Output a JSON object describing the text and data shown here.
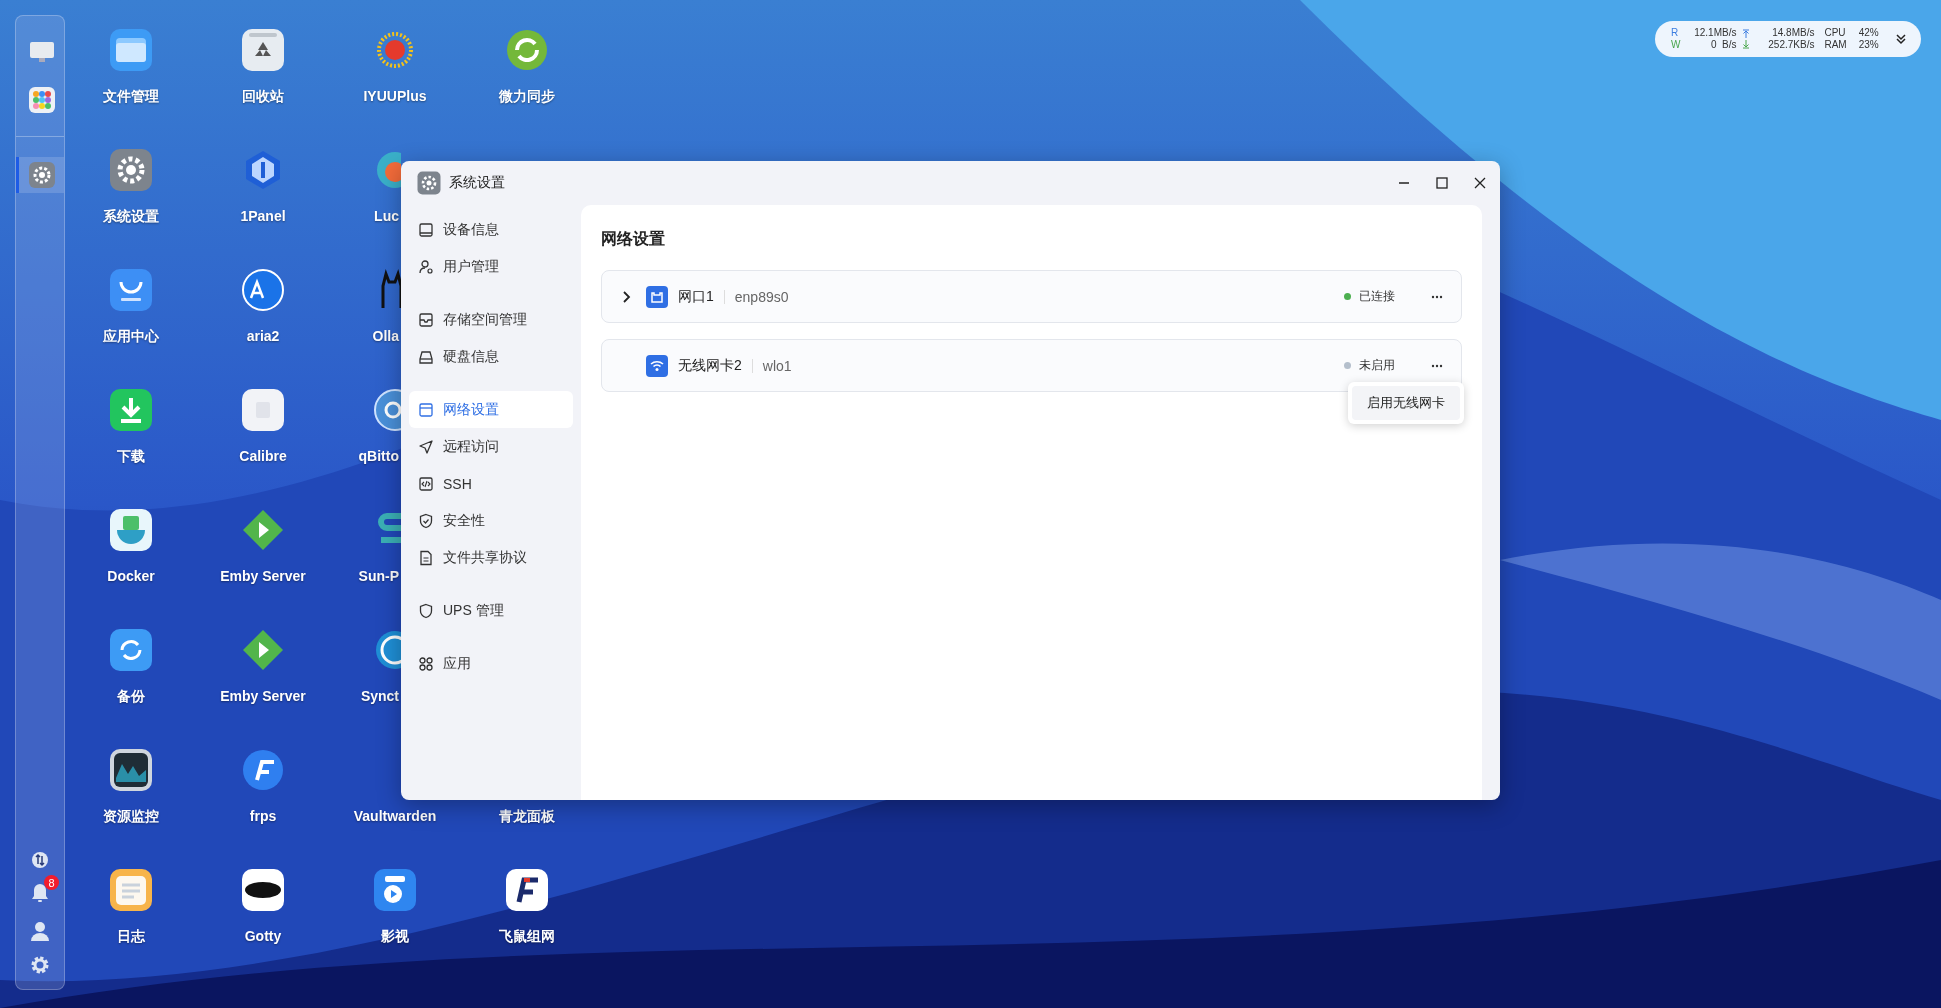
{
  "desktop": {
    "rows": [
      [
        {
          "label": "文件管理"
        },
        {
          "label": "回收站"
        },
        {
          "label": "IYUUPlus"
        },
        {
          "label": "微力同步"
        }
      ],
      [
        {
          "label": "系统设置"
        },
        {
          "label": "1Panel"
        },
        {
          "label": "Luc",
          "cut": true
        }
      ],
      [
        {
          "label": "应用中心"
        },
        {
          "label": "aria2"
        },
        {
          "label": "Olla",
          "cut": true
        }
      ],
      [
        {
          "label": "下载"
        },
        {
          "label": "Calibre"
        },
        {
          "label": "qBitto",
          "cut": true
        }
      ],
      [
        {
          "label": "Docker"
        },
        {
          "label": "Emby Server"
        },
        {
          "label": "Sun-P",
          "cut": true
        }
      ],
      [
        {
          "label": "备份"
        },
        {
          "label": "Emby Server"
        },
        {
          "label": "Synct",
          "cut": true
        }
      ],
      [
        {
          "label": "资源监控"
        },
        {
          "label": "frps"
        },
        {
          "label": "Vaultwarden"
        },
        {
          "label": "青龙面板"
        }
      ],
      [
        {
          "label": "日志"
        },
        {
          "label": "Gotty"
        },
        {
          "label": "影视"
        },
        {
          "label": "飞鼠组网"
        }
      ]
    ]
  },
  "dock": {
    "apps": [
      {
        "selected": false
      },
      {
        "selected": false
      },
      {
        "selected": true
      }
    ],
    "notification_badge": "8"
  },
  "status_widget": {
    "read_label": "R",
    "write_label": "W",
    "read": "12.1MB/s",
    "write": "0  B/s",
    "upload": "14.8MB/s",
    "download": "252.7KB/s",
    "cpu_label": "CPU",
    "cpu": "42%",
    "ram_label": "RAM",
    "ram": "23%"
  },
  "window": {
    "title": "系统设置",
    "sidebar": [
      [
        {
          "label": "设备信息",
          "selected": false
        },
        {
          "label": "用户管理",
          "selected": false
        }
      ],
      [
        {
          "label": "存储空间管理",
          "selected": false
        },
        {
          "label": "硬盘信息",
          "selected": false
        }
      ],
      [
        {
          "label": "网络设置",
          "selected": true
        },
        {
          "label": "远程访问",
          "selected": false
        },
        {
          "label": "SSH",
          "selected": false
        },
        {
          "label": "安全性",
          "selected": false
        },
        {
          "label": "文件共享协议",
          "selected": false
        }
      ],
      [
        {
          "label": "UPS 管理",
          "selected": false
        }
      ],
      [
        {
          "label": "应用",
          "selected": false
        }
      ]
    ],
    "heading": "网络设置",
    "interfaces": [
      {
        "kind": "ethernet",
        "name": "网口1",
        "device": "enp89s0",
        "status": "已连接",
        "connected": true,
        "expandable": true
      },
      {
        "kind": "wifi",
        "name": "无线网卡2",
        "device": "wlo1",
        "status": "未启用",
        "connected": false,
        "expandable": false
      }
    ],
    "context_menu": {
      "items": [
        "启用无线网卡"
      ]
    }
  }
}
